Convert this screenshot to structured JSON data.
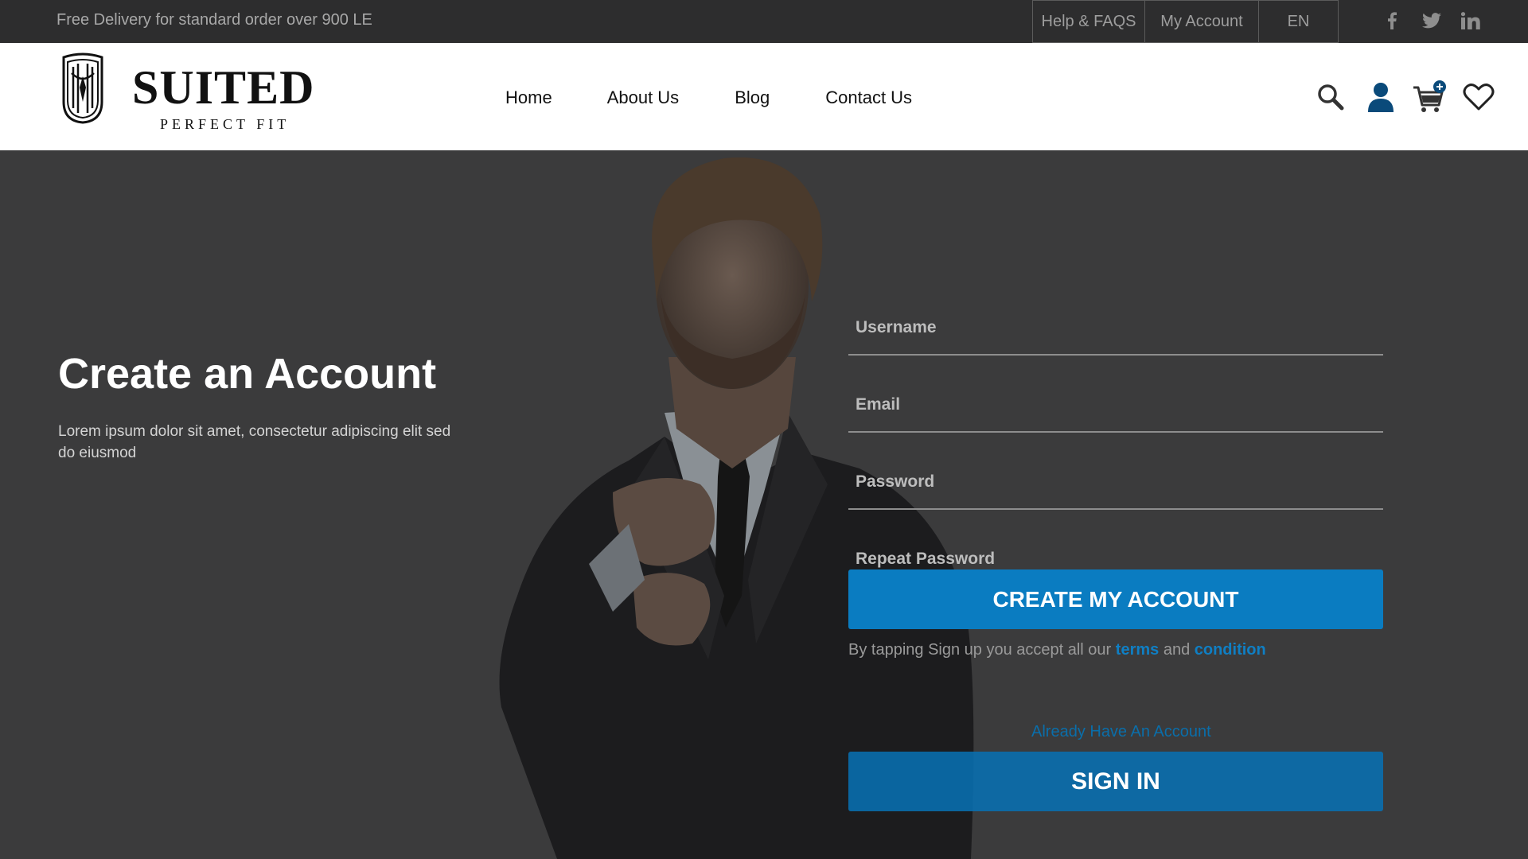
{
  "topbar": {
    "promo": "Free Delivery for standard order over 900 LE",
    "links": {
      "help": "Help & FAQS",
      "account": "My Account",
      "lang": "EN"
    },
    "socials": [
      "facebook-icon",
      "twitter-icon",
      "linkedin-icon"
    ]
  },
  "header": {
    "brand": "SUITED",
    "tagline": "PERFECT FIT",
    "nav": {
      "home": "Home",
      "about": "About Us",
      "blog": "Blog",
      "contact": "Contact Us"
    },
    "icons": [
      "search-icon",
      "user-icon",
      "cart-icon",
      "heart-icon"
    ]
  },
  "hero": {
    "title": "Create an Account",
    "text": "Lorem ipsum dolor sit amet, consectetur adipiscing elit sed do eiusmod"
  },
  "form": {
    "username_placeholder": "Username",
    "email_placeholder": "Email",
    "password_placeholder": "Password",
    "repeat_placeholder": "Repeat Password",
    "create_label": "CREATE MY ACCOUNT",
    "terms_prefix": "By tapping Sign up you accept all our ",
    "terms_link": "terms",
    "terms_and": " and ",
    "condition_link": "condition",
    "already_label": "Already Have An Account",
    "signin_label": "SIGN IN"
  },
  "colors": {
    "accent": "#0a7cc1",
    "topbar": "#2d2d2e",
    "hero_bg": "#3b3b3c"
  }
}
